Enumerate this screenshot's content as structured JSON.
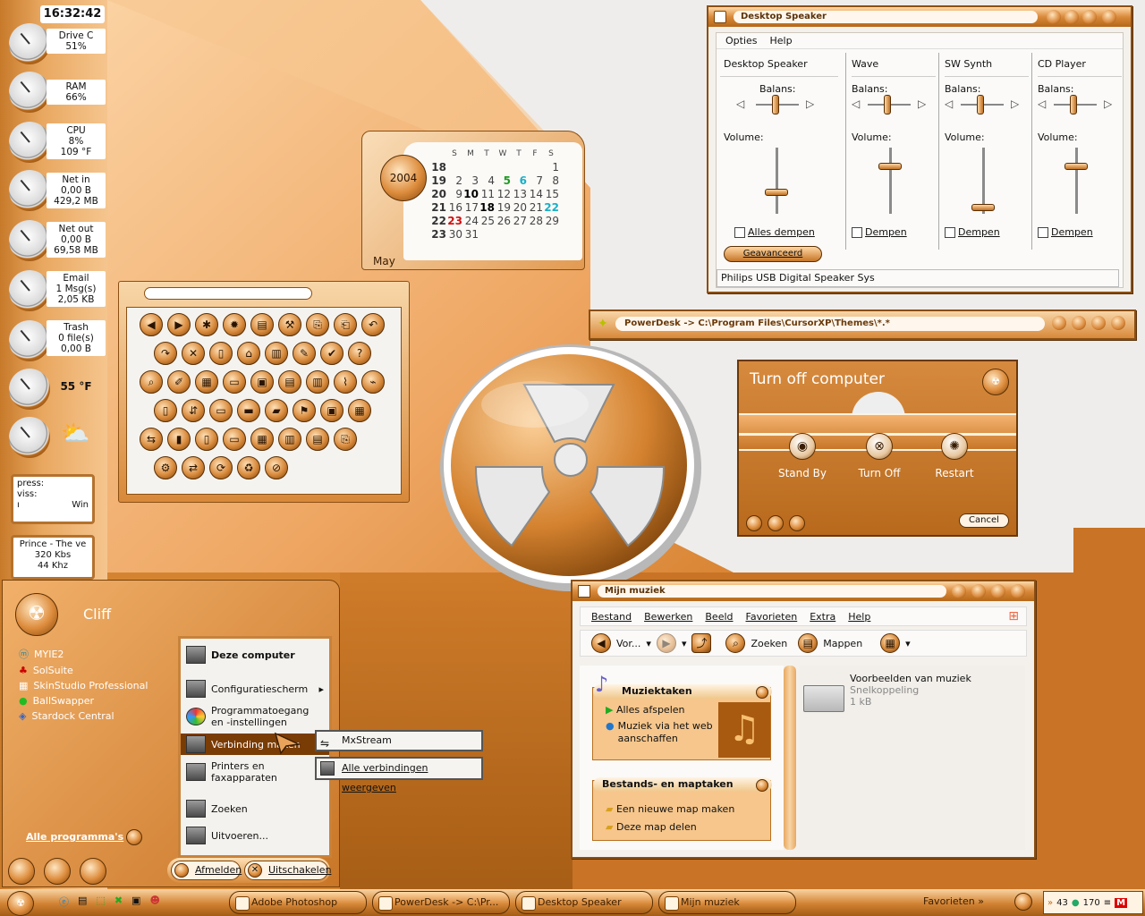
{
  "sidebar": {
    "time": "16:32:42",
    "monitors": [
      {
        "label": "Drive C",
        "lines": [
          "51%"
        ]
      },
      {
        "label": "RAM",
        "lines": [
          "66%"
        ]
      },
      {
        "label": "CPU",
        "lines": [
          "8%",
          "109 °F"
        ]
      },
      {
        "label": "Net in",
        "lines": [
          "0,00 B",
          "429,2 MB"
        ]
      },
      {
        "label": "Net out",
        "lines": [
          "0,00 B",
          "69,58 MB"
        ]
      },
      {
        "label": "Email",
        "lines": [
          "1 Msg(s)",
          "2,05 KB"
        ]
      },
      {
        "label": "Trash",
        "lines": [
          "0 file(s)",
          "0,00 B"
        ]
      }
    ],
    "temperature": "55 °F",
    "box1": {
      "line1": "press:",
      "line2": "viss:",
      "line3a": "ı",
      "line3b": "Win"
    },
    "box2": {
      "line1": "Prince - The ve",
      "line2": "320 Kbs",
      "line3": "44 Khz"
    }
  },
  "calendar": {
    "year": "2004",
    "month": "May",
    "weekdays": [
      "S",
      "M",
      "T",
      "W",
      "T",
      "F",
      "S"
    ],
    "rows": [
      {
        "week": "18",
        "days": [
          "",
          "",
          "",
          "",
          "",
          "",
          "1"
        ]
      },
      {
        "week": "19",
        "days": [
          "2",
          "3",
          "4",
          "5",
          "6",
          "7",
          "8"
        ]
      },
      {
        "week": "20",
        "days": [
          "9",
          "10",
          "11",
          "12",
          "13",
          "14",
          "15"
        ]
      },
      {
        "week": "21",
        "days": [
          "16",
          "17",
          "18",
          "19",
          "20",
          "21",
          "22"
        ]
      },
      {
        "week": "22",
        "days": [
          "23",
          "24",
          "25",
          "26",
          "27",
          "28",
          "29"
        ]
      },
      {
        "week": "23",
        "days": [
          "30",
          "31",
          "",
          "",
          "",
          "",
          ""
        ]
      }
    ],
    "colors": {
      "green": "#1e9b22",
      "cyan": "#1ab0c8",
      "red": "#d01010"
    }
  },
  "speaker": {
    "title": "Desktop Speaker",
    "menu": [
      "Opties",
      "Help"
    ],
    "channels": [
      {
        "name": "Desktop Speaker",
        "balance": "Balans:",
        "volume": "Volume:",
        "mute": "Alles dempen",
        "vol": 0.3
      },
      {
        "name": "Wave",
        "balance": "Balans:",
        "volume": "Volume:",
        "mute": "Dempen",
        "vol": 0.75
      },
      {
        "name": "SW Synth",
        "balance": "Balans:",
        "volume": "Volume:",
        "mute": "Dempen",
        "vol": 0.05
      },
      {
        "name": "CD Player",
        "balance": "Balans:",
        "volume": "Volume:",
        "mute": "Dempen",
        "vol": 0.75
      }
    ],
    "advanced": "Geavanceerd",
    "status": "Philips USB Digital Speaker Sys"
  },
  "powerdesk": {
    "title": "PowerDesk -> C:\\Program Files\\CursorXP\\Themes\\*.*"
  },
  "turnoff": {
    "title": "Turn off computer",
    "buttons": [
      {
        "label": "Stand By",
        "glyph": "◉"
      },
      {
        "label": "Turn Off",
        "glyph": "⊗"
      },
      {
        "label": "Restart",
        "glyph": "✺"
      }
    ],
    "cancel": "Cancel"
  },
  "iconpanel": {
    "rows": [
      [
        "◀",
        "▶",
        "✱",
        "✹",
        "▤",
        "⚒",
        "⎘",
        "⎗",
        "↶"
      ],
      [
        "↷",
        "✕",
        "▯",
        "⌂",
        "▥",
        "✎",
        "✔",
        "?"
      ],
      [
        "⌕",
        "✐",
        "▦",
        "▭",
        "▣",
        "▤",
        "▥",
        "⌇",
        "⌁"
      ],
      [
        "▯",
        "⇵",
        "▭",
        "▬",
        "▰",
        "⚑",
        "▣",
        "▦"
      ],
      [
        "⇆",
        "▮",
        "▯",
        "▭",
        "▦",
        "▥",
        "▤",
        "⎘"
      ],
      [
        "⚙",
        "⇄",
        "⟳",
        "♻",
        "⊘"
      ]
    ]
  },
  "startmenu": {
    "user": "Cliff",
    "pinned": [
      "MYIE2",
      "SolSuite",
      "SkinStudio Professional",
      "BallSwapper",
      "Stardock Central"
    ],
    "all_programs": "Alle programma's",
    "right": [
      "Deze computer",
      "Configuratiescherm",
      "Programmatoegang en -instellingen",
      "Verbinding maken",
      "Printers en faxapparaten",
      "Zoeken",
      "Uitvoeren..."
    ],
    "logoff": "Afmelden",
    "shutdown": "Uitschakelen",
    "submenu": [
      "MxStream",
      "Alle verbindingen weergeven"
    ]
  },
  "mymusic": {
    "title": "Mijn muziek",
    "menu": [
      "Bestand",
      "Bewerken",
      "Beeld",
      "Favorieten",
      "Extra",
      "Help"
    ],
    "toolbar": {
      "back": "Vor...",
      "search": "Zoeken",
      "folders": "Mappen"
    },
    "panel1": {
      "title": "Muziektaken",
      "items": [
        "Alles afspelen",
        "Muziek via het web aanschaffen"
      ]
    },
    "panel2": {
      "title": "Bestands- en maptaken",
      "items": [
        "Een nieuwe map maken",
        "Deze map delen"
      ]
    },
    "file": {
      "name": "Voorbeelden van muziek",
      "type": "Snelkoppeling",
      "size": "1 kB"
    }
  },
  "taskbar": {
    "tasks": [
      "Adobe Photoshop",
      "PowerDesk -> C:\\Pr...",
      "Desktop Speaker",
      "Mijn muziek"
    ],
    "favorites": "Favorieten",
    "tray": [
      "43",
      "170"
    ]
  },
  "colors": {
    "accent": "#d9893a",
    "dark": "#8b4f13",
    "light": "#f8c892"
  }
}
